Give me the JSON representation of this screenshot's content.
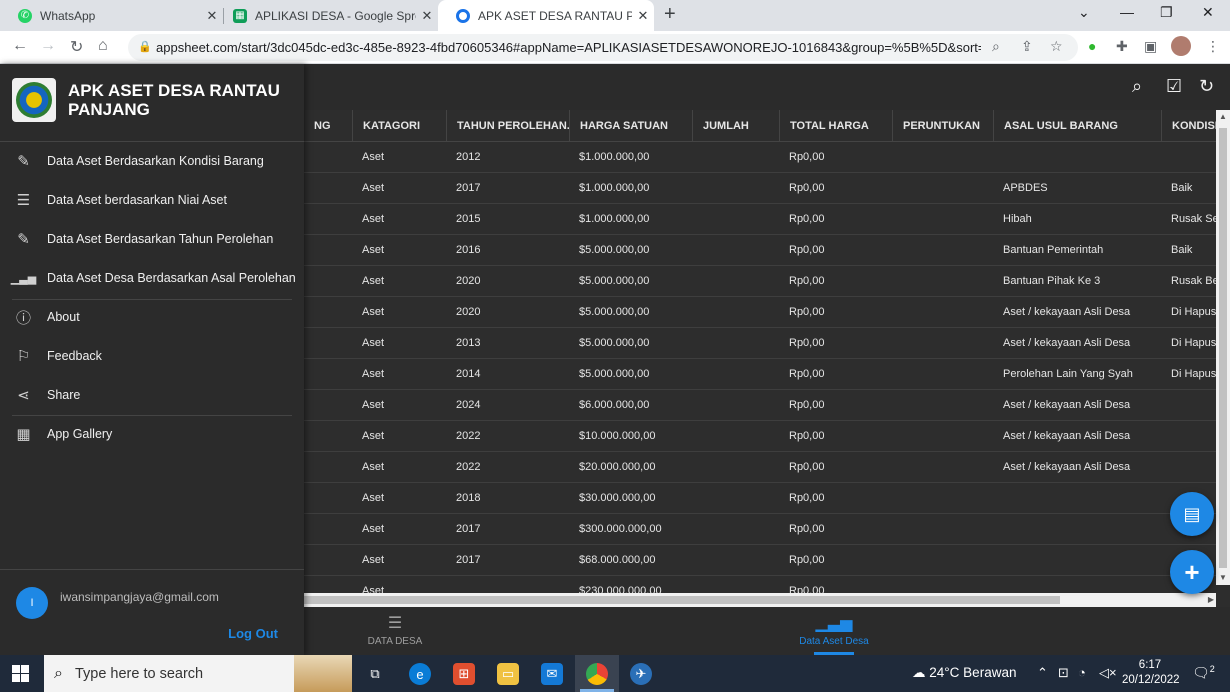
{
  "browser": {
    "tabs": [
      {
        "title": "WhatsApp",
        "icon": "whatsapp-icon",
        "color": "#25D366"
      },
      {
        "title": "APLIKASI DESA - Google Spreads",
        "icon": "sheets-icon",
        "color": "#0F9D58"
      },
      {
        "title": "APK ASET DESA RANTAU PANJAI",
        "icon": "appsheet-icon",
        "color": "#1a73e8"
      }
    ],
    "url": "appsheet.com/start/3dc045dc-ed3c-485e-8923-4fbd70605346#appName=APLIKASIASETDESAWONOREJO-1016843&group=%5B%5D&sort=%5B..."
  },
  "app": {
    "title": "APK ASET DESA RANTAU PANJANG",
    "menu": [
      {
        "label": "Data Aset Berdasarkan Kondisi Barang",
        "icon": "edit-icon",
        "name": "kondisi-barang"
      },
      {
        "label": "Data Aset berdasarkan Niai Aset",
        "icon": "list-icon",
        "name": "nilai-aset"
      },
      {
        "label": "Data Aset Berdasarkan Tahun Perolehan",
        "icon": "edit-icon",
        "name": "tahun-perolehan"
      },
      {
        "label": "Data Aset Desa Berdasarkan Asal Perolehan",
        "icon": "chart-icon",
        "name": "asal-perolehan"
      }
    ],
    "menu2": [
      {
        "label": "About",
        "icon": "info-icon",
        "name": "about"
      },
      {
        "label": "Feedback",
        "icon": "feedback-icon",
        "name": "feedback"
      },
      {
        "label": "Share",
        "icon": "share-icon",
        "name": "share"
      }
    ],
    "menu3": [
      {
        "label": "App Gallery",
        "icon": "grid-icon",
        "name": "app-gallery"
      }
    ],
    "account": {
      "initial": "I",
      "email": "iwansimpangjaya@gmail.com",
      "logout": "Log Out"
    },
    "table": {
      "columns": [
        "NG",
        "KATAGORI",
        "TAHUN PEROLEHAN...",
        "HARGA SATUAN",
        "JUMLAH",
        "TOTAL HARGA",
        "PERUNTUKAN",
        "ASAL USUL BARANG",
        "KONDISI"
      ],
      "rows": [
        [
          "",
          "Aset",
          "2012",
          "$1.000.000,00",
          "",
          "Rp0,00",
          "",
          "",
          ""
        ],
        [
          "",
          "Aset",
          "2017",
          "$1.000.000,00",
          "",
          "Rp0,00",
          "",
          "APBDES",
          "Baik"
        ],
        [
          "",
          "Aset",
          "2015",
          "$1.000.000,00",
          "",
          "Rp0,00",
          "",
          "Hibah",
          "Rusak Se"
        ],
        [
          "",
          "Aset",
          "2016",
          "$5.000.000,00",
          "",
          "Rp0,00",
          "",
          "Bantuan Pemerintah",
          "Baik"
        ],
        [
          "",
          "Aset",
          "2020",
          "$5.000.000,00",
          "",
          "Rp0,00",
          "",
          "Bantuan Pihak Ke 3",
          "Rusak Be"
        ],
        [
          "",
          "Aset",
          "2020",
          "$5.000.000,00",
          "",
          "Rp0,00",
          "",
          "Aset / kekayaan Asli Desa",
          "Di Hapusk"
        ],
        [
          "",
          "Aset",
          "2013",
          "$5.000.000,00",
          "",
          "Rp0,00",
          "",
          "Aset / kekayaan Asli Desa",
          "Di Hapusk"
        ],
        [
          "",
          "Aset",
          "2014",
          "$5.000.000,00",
          "",
          "Rp0,00",
          "",
          "Perolehan Lain Yang Syah",
          "Di Hapusk"
        ],
        [
          "",
          "Aset",
          "2024",
          "$6.000.000,00",
          "",
          "Rp0,00",
          "",
          "Aset / kekayaan Asli Desa",
          ""
        ],
        [
          "",
          "Aset",
          "2022",
          "$10.000.000,00",
          "",
          "Rp0,00",
          "",
          "Aset / kekayaan Asli Desa",
          ""
        ],
        [
          "",
          "Aset",
          "2022",
          "$20.000.000,00",
          "",
          "Rp0,00",
          "",
          "Aset / kekayaan Asli Desa",
          ""
        ],
        [
          "",
          "Aset",
          "2018",
          "$30.000.000,00",
          "",
          "Rp0,00",
          "",
          "",
          ""
        ],
        [
          "",
          "Aset",
          "2017",
          "$300.000.000,00",
          "",
          "Rp0,00",
          "",
          "",
          ""
        ],
        [
          "",
          "Aset",
          "2017",
          "$68.000.000,00",
          "",
          "Rp0,00",
          "",
          "",
          ""
        ],
        [
          "",
          "Aset",
          "",
          "$230.000.000,00",
          "",
          "Rp0,00",
          "",
          "",
          ""
        ]
      ]
    },
    "bottom_nav": [
      {
        "label": "DATA DESA",
        "icon": "list-icon",
        "active": false
      },
      {
        "label": "Data Aset Desa",
        "icon": "chart-icon",
        "active": true
      }
    ],
    "accent": "#1e88e5"
  },
  "taskbar": {
    "search_placeholder": "Type here to search",
    "weather": "24°C  Berawan",
    "time": "6:17",
    "date": "20/12/2022",
    "notifications": "2"
  }
}
